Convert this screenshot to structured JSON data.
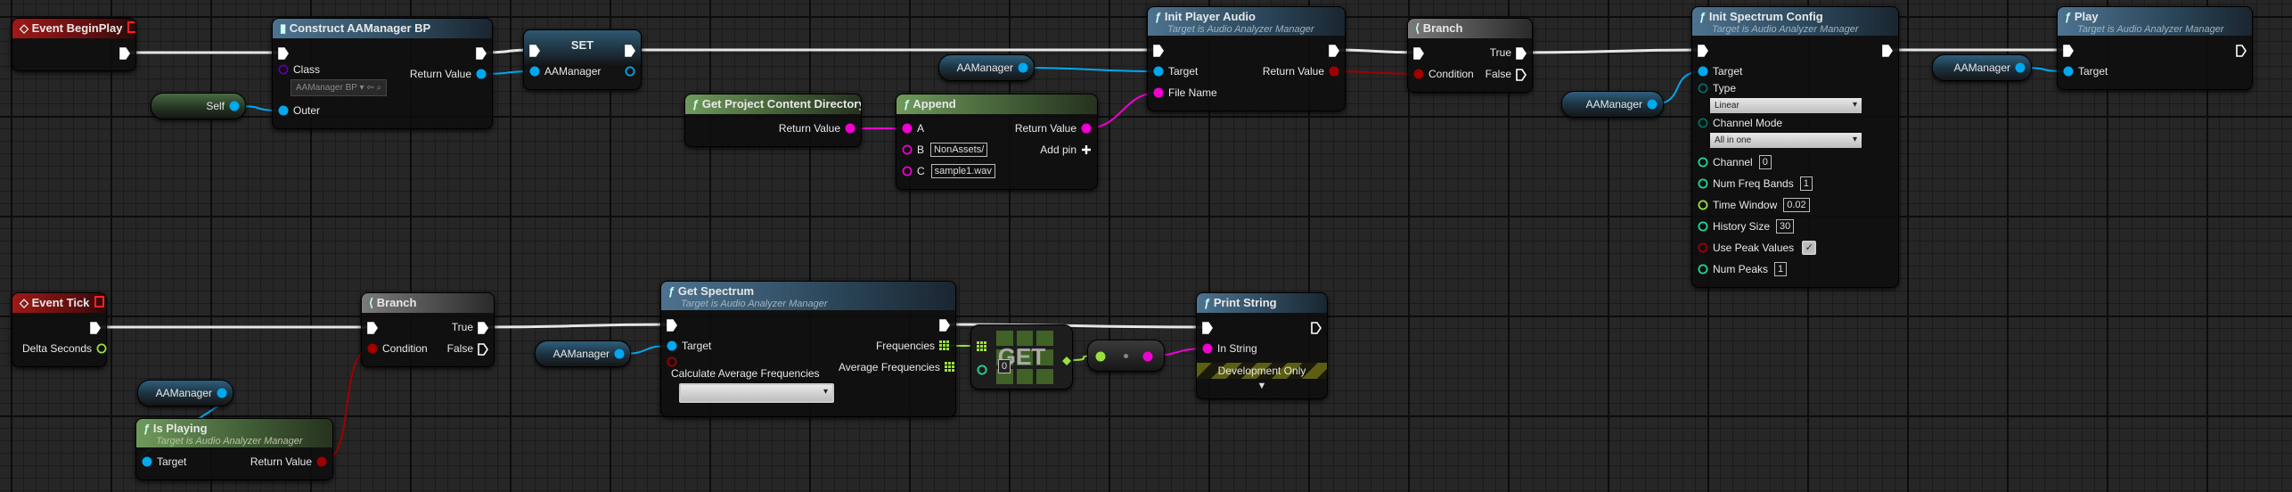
{
  "pin_colors": {
    "exec": "#ffffff",
    "object": "#00a8f0",
    "string": "#f000d0",
    "bool": "#a00000",
    "float": "#9ae03c",
    "int": "#1ed8a0",
    "byte": "#006d5e",
    "class": "#5a00a8",
    "array": "#9ae03c"
  },
  "nodes": [
    {
      "id": "event_begin_play",
      "kind": "event",
      "title": "Event BeginPlay",
      "rows": [
        {
          "r": {
            "id": "exec_out",
            "pin": "exec"
          }
        }
      ]
    },
    {
      "id": "construct",
      "kind": "construct",
      "title": "Construct AAManager BP",
      "rows": [
        {
          "l": {
            "id": "exec_in",
            "pin": "exec"
          },
          "r": {
            "id": "exec_out",
            "pin": "exec"
          }
        },
        {
          "l": {
            "id": "class",
            "pin": "class",
            "hollow": true,
            "label": "Class",
            "dropdown": "AAManager BP ▾ ⇦ ⌕"
          },
          "r": {
            "id": "return_value",
            "pin": "object",
            "label": "Return Value"
          }
        },
        {
          "l": {
            "id": "outer",
            "pin": "object",
            "label": "Outer"
          }
        }
      ]
    },
    {
      "id": "set",
      "kind": "set",
      "title": "SET",
      "rows": [
        {
          "l": {
            "id": "exec_in",
            "pin": "exec"
          },
          "r": {
            "id": "exec_out",
            "pin": "exec"
          }
        },
        {
          "l": {
            "id": "aamanager",
            "pin": "object",
            "label": "AAManager"
          },
          "r": {
            "id": "out",
            "pin": "object",
            "hollow": true
          }
        }
      ]
    },
    {
      "id": "init_player_audio",
      "kind": "func",
      "title": "Init Player Audio",
      "subtitle": "Target is Audio Analyzer Manager",
      "rows": [
        {
          "l": {
            "id": "exec_in",
            "pin": "exec"
          },
          "r": {
            "id": "exec_out",
            "pin": "exec"
          }
        },
        {
          "l": {
            "id": "target",
            "pin": "object",
            "label": "Target"
          },
          "r": {
            "id": "return_value",
            "pin": "bool",
            "label": "Return Value"
          }
        },
        {
          "l": {
            "id": "file_name",
            "pin": "string",
            "label": "File Name"
          }
        }
      ]
    },
    {
      "id": "get_project_content_directory",
      "kind": "pure",
      "title": "Get Project Content Directory",
      "rows": [
        {
          "r": {
            "id": "return_value",
            "pin": "string",
            "label": "Return Value"
          }
        }
      ]
    },
    {
      "id": "append",
      "kind": "pure",
      "title": "Append",
      "rows": [
        {
          "l": {
            "id": "a",
            "pin": "string",
            "label": "A"
          },
          "r": {
            "id": "return_value",
            "pin": "string",
            "label": "Return Value"
          }
        },
        {
          "l": {
            "id": "b",
            "pin": "string",
            "hollow": true,
            "label": "B",
            "value": "NonAssets/"
          },
          "r": {
            "id": "add_pin",
            "pin": "add",
            "label": "Add pin"
          }
        },
        {
          "l": {
            "id": "c",
            "pin": "string",
            "hollow": true,
            "label": "C",
            "value": "sample1.wav"
          }
        }
      ]
    },
    {
      "id": "branch_top",
      "kind": "branch",
      "title": "Branch",
      "rows": [
        {
          "l": {
            "id": "exec_in",
            "pin": "exec"
          },
          "r": {
            "id": "true",
            "pin": "exec",
            "label": "True"
          }
        },
        {
          "l": {
            "id": "condition",
            "pin": "bool",
            "label": "Condition"
          },
          "r": {
            "id": "false",
            "pin": "exec",
            "hollow": true,
            "label": "False"
          }
        }
      ]
    },
    {
      "id": "init_spectrum_config",
      "kind": "func",
      "title": "Init Spectrum Config",
      "subtitle": "Target is Audio Analyzer Manager",
      "rows": [
        {
          "l": {
            "id": "exec_in",
            "pin": "exec"
          },
          "r": {
            "id": "exec_out",
            "pin": "exec"
          }
        },
        {
          "l": {
            "id": "target",
            "pin": "object",
            "label": "Target"
          }
        },
        {
          "l": {
            "id": "type",
            "pin": "byte",
            "hollow": true,
            "label": "Type",
            "dropdown": "Linear"
          }
        },
        {
          "l": {
            "id": "channel_mode",
            "pin": "byte",
            "hollow": true,
            "label": "Channel Mode",
            "dropdown": "All in one"
          }
        },
        {
          "l": {
            "id": "channel",
            "pin": "int",
            "hollow": true,
            "label": "Channel",
            "value": "0"
          }
        },
        {
          "l": {
            "id": "num_freq_bands",
            "pin": "int",
            "hollow": true,
            "label": "Num Freq Bands",
            "value": "1"
          }
        },
        {
          "l": {
            "id": "time_window",
            "pin": "float",
            "hollow": true,
            "label": "Time Window",
            "value": "0.02"
          }
        },
        {
          "l": {
            "id": "history_size",
            "pin": "int",
            "hollow": true,
            "label": "History Size",
            "value": "30"
          }
        },
        {
          "l": {
            "id": "use_peak_values",
            "pin": "bool",
            "hollow": true,
            "label": "Use Peak Values",
            "checked": true
          }
        },
        {
          "l": {
            "id": "num_peaks",
            "pin": "int",
            "hollow": true,
            "label": "Num Peaks",
            "value": "1"
          }
        }
      ]
    },
    {
      "id": "play",
      "kind": "func",
      "title": "Play",
      "subtitle": "Target is Audio Analyzer Manager",
      "rows": [
        {
          "l": {
            "id": "exec_in",
            "pin": "exec"
          },
          "r": {
            "id": "exec_out",
            "pin": "exec",
            "hollow": true
          }
        },
        {
          "l": {
            "id": "target",
            "pin": "object",
            "label": "Target"
          }
        }
      ]
    },
    {
      "id": "event_tick",
      "kind": "event",
      "title": "Event Tick",
      "rows": [
        {
          "r": {
            "id": "exec_out",
            "pin": "exec"
          }
        },
        {
          "r": {
            "id": "delta_seconds",
            "pin": "float",
            "hollow": true,
            "label": "Delta Seconds"
          }
        }
      ]
    },
    {
      "id": "branch_bottom",
      "kind": "branch",
      "title": "Branch",
      "rows": [
        {
          "l": {
            "id": "exec_in",
            "pin": "exec"
          },
          "r": {
            "id": "true",
            "pin": "exec",
            "label": "True"
          }
        },
        {
          "l": {
            "id": "condition",
            "pin": "bool",
            "label": "Condition"
          },
          "r": {
            "id": "false",
            "pin": "exec",
            "hollow": true,
            "label": "False"
          }
        }
      ]
    },
    {
      "id": "get_spectrum",
      "kind": "func",
      "title": "Get Spectrum",
      "subtitle": "Target is Audio Analyzer Manager",
      "rows": [
        {
          "l": {
            "id": "exec_in",
            "pin": "exec"
          },
          "r": {
            "id": "exec_out",
            "pin": "exec"
          }
        },
        {
          "l": {
            "id": "target",
            "pin": "object",
            "label": "Target"
          },
          "r": {
            "id": "frequencies",
            "pin": "array",
            "label": "Frequencies"
          }
        },
        {
          "l": {
            "id": "calc_avg",
            "pin": "bool",
            "hollow": true,
            "label": "Calculate Average Frequencies",
            "checkbox_below": true
          },
          "r": {
            "id": "average_frequencies",
            "pin": "array",
            "label": "Average Frequencies"
          }
        }
      ]
    },
    {
      "id": "is_playing",
      "kind": "pure",
      "title": "Is Playing",
      "subtitle": "Target is Audio Analyzer Manager",
      "rows": [
        {
          "l": {
            "id": "target",
            "pin": "object",
            "label": "Target"
          },
          "r": {
            "id": "return_value",
            "pin": "bool",
            "label": "Return Value"
          }
        }
      ]
    },
    {
      "id": "print_string",
      "kind": "func",
      "title": "Print String",
      "footer": "Development Only",
      "rows": [
        {
          "l": {
            "id": "exec_in",
            "pin": "exec"
          },
          "r": {
            "id": "exec_out",
            "pin": "exec",
            "hollow": true
          }
        },
        {
          "l": {
            "id": "in_string",
            "pin": "string",
            "label": "In String"
          }
        }
      ]
    }
  ],
  "variables": [
    {
      "id": "self",
      "label": "Self",
      "pin": "object",
      "kind": "self"
    },
    {
      "id": "aamanager_1",
      "label": "AAManager",
      "pin": "object"
    },
    {
      "id": "aamanager_2",
      "label": "AAManager",
      "pin": "object"
    },
    {
      "id": "aamanager_3",
      "label": "AAManager",
      "pin": "object"
    },
    {
      "id": "aamanager_4",
      "label": "AAManager",
      "pin": "object"
    },
    {
      "id": "aamanager_5",
      "label": "AAManager",
      "pin": "object"
    }
  ],
  "array_get": {
    "id": "get",
    "label": "GET",
    "index": "0"
  },
  "conversion": {
    "id": "to_string"
  },
  "links": [
    [
      "event_begin_play.exec_out",
      "construct.exec_in",
      "exec"
    ],
    [
      "construct.exec_out",
      "set.exec_in",
      "exec"
    ],
    [
      "construct.return_value",
      "set.aamanager",
      "object"
    ],
    [
      "self.out",
      "construct.outer",
      "object"
    ],
    [
      "set.exec_out",
      "init_player_audio.exec_in",
      "exec"
    ],
    [
      "aamanager_1.out",
      "init_player_audio.target",
      "object"
    ],
    [
      "get_project_content_directory.return_value",
      "append.a",
      "string"
    ],
    [
      "append.return_value",
      "init_player_audio.file_name",
      "string"
    ],
    [
      "init_player_audio.exec_out",
      "branch_top.exec_in",
      "exec"
    ],
    [
      "init_player_audio.return_value",
      "branch_top.condition",
      "bool"
    ],
    [
      "branch_top.true",
      "init_spectrum_config.exec_in",
      "exec"
    ],
    [
      "aamanager_2.out",
      "init_spectrum_config.target",
      "object"
    ],
    [
      "init_spectrum_config.exec_out",
      "play.exec_in",
      "exec"
    ],
    [
      "aamanager_3.out",
      "play.target",
      "object"
    ],
    [
      "event_tick.exec_out",
      "branch_bottom.exec_in",
      "exec"
    ],
    [
      "branch_bottom.true",
      "get_spectrum.exec_in",
      "exec"
    ],
    [
      "aamanager_5.out",
      "get_spectrum.target",
      "object"
    ],
    [
      "aamanager_4.out",
      "is_playing.target",
      "object"
    ],
    [
      "is_playing.return_value",
      "branch_bottom.condition",
      "bool"
    ],
    [
      "get_spectrum.exec_out",
      "print_string.exec_in",
      "exec"
    ],
    [
      "get_spectrum.frequencies",
      "get.array",
      "array"
    ],
    [
      "get.out",
      "to_string.in",
      "float"
    ],
    [
      "to_string.out",
      "print_string.in_string",
      "string"
    ]
  ]
}
